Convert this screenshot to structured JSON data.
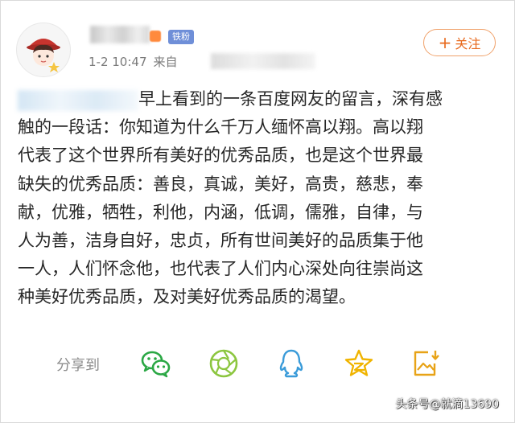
{
  "header": {
    "fan_badge": "铁粉",
    "date": "1-2 10:47",
    "source_prefix": "来自",
    "follow_label": "关注"
  },
  "post": {
    "lines": [
      "早上看到的一条百度网友的留言，深有感",
      "触的一段话：你知道为什么千万人缅怀高以翔。高以翔",
      "代表了这个世界所有美好的优秀品质，也是这个世界最",
      "缺失的优秀品质：善良，真诚，美好，高贵，慈悲，奉",
      "献，优雅，牺牲，利他，内涵，低调，儒雅，自律，与",
      "人为善，洁身自好，忠贞，所有世间美好的品质集于他",
      "一人，人们怀念他，也代表了人们内心深处向往崇尚这",
      "种美好优秀品质，及对美好优秀品质的渴望。"
    ]
  },
  "share": {
    "label": "分享到",
    "targets": [
      "wechat-icon",
      "moments-icon",
      "qq-icon",
      "qzone-icon",
      "save-image-icon"
    ]
  },
  "colors": {
    "accent_orange": "#e86a1e",
    "icon_green": "#2aa744",
    "icon_blue": "#3a9bd9",
    "icon_gold": "#f0b400",
    "badge_blue": "#6f8fd8"
  },
  "watermark": "头条号@就滴13690"
}
